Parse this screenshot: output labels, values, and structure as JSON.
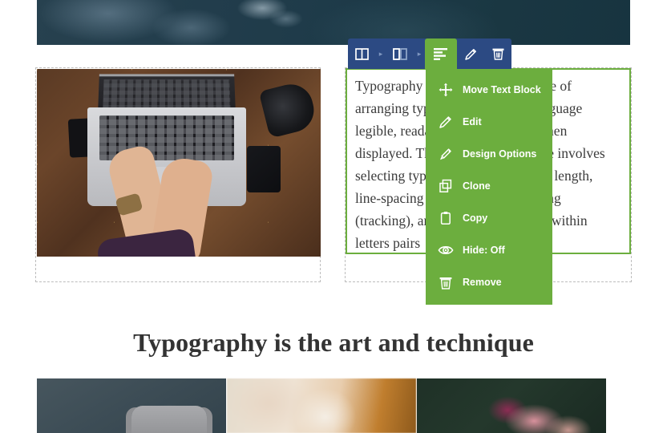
{
  "page": {
    "hero_image_alt": "aerial-ocean-water-photo"
  },
  "main_row": {
    "left_column": {
      "image_alt": "laptop-flatlay-wooden-desk-photo"
    },
    "right_column": {
      "text_block": {
        "body": "Typography is the art and technique of arranging type to make written language legible, readable, and appealing when displayed. The arrangement of type involves selecting typefaces, point size, line length, line-spacing (leading), letter-spacing (tracking), and adjusting the space within letters pairs"
      }
    }
  },
  "heading": {
    "text": "Typography is the art and technique"
  },
  "gallery": {
    "items": [
      {
        "alt": "grey-armchair-against-dark-wall-photo"
      },
      {
        "alt": "blurred-pastel-interior-photo"
      },
      {
        "alt": "pink-flower-on-dark-green-photo"
      }
    ]
  },
  "toolbar": {
    "background_color": "#2c4a83",
    "active_color": "#6cae3e",
    "buttons": [
      {
        "name": "parent-row-layout",
        "icon": "columns-icon",
        "label": ""
      },
      {
        "name": "breadcrumb-separator-1",
        "icon": "chevron-right-icon",
        "label": "▸"
      },
      {
        "name": "parent-column-layout",
        "icon": "columns-icon",
        "label": ""
      },
      {
        "name": "breadcrumb-separator-2",
        "icon": "chevron-right-icon",
        "label": "▸"
      },
      {
        "name": "text-block-active",
        "icon": "text-align-left-icon",
        "label": ""
      },
      {
        "name": "edit-element",
        "icon": "pencil-icon",
        "label": ""
      },
      {
        "name": "delete-element",
        "icon": "trash-icon",
        "label": ""
      }
    ]
  },
  "context_menu": {
    "background_color": "#6cae3e",
    "items": [
      {
        "icon": "move-arrows-icon",
        "label": "Move Text Block"
      },
      {
        "icon": "pencil-icon",
        "label": "Edit"
      },
      {
        "icon": "paintbrush-icon",
        "label": "Design Options"
      },
      {
        "icon": "clone-icon",
        "label": "Clone"
      },
      {
        "icon": "clipboard-icon",
        "label": "Copy"
      },
      {
        "icon": "eye-icon",
        "label": "Hide: Off"
      },
      {
        "icon": "trash-icon",
        "label": "Remove"
      }
    ]
  }
}
